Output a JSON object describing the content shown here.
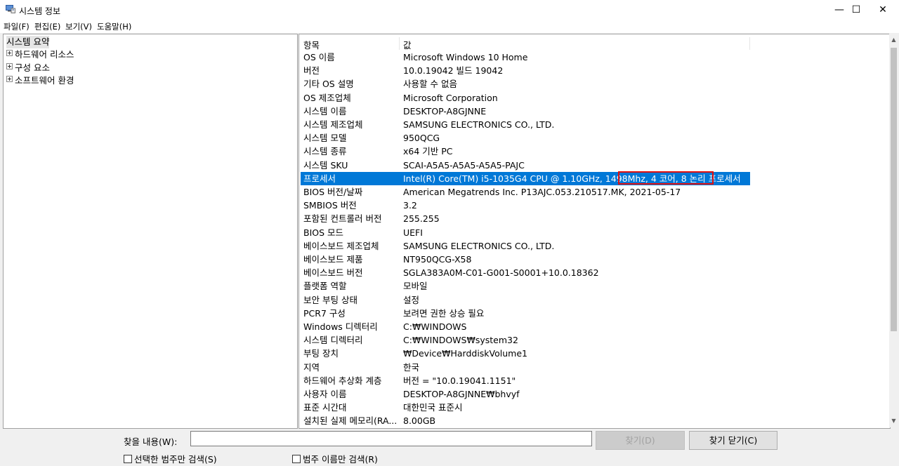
{
  "window": {
    "title": "시스템 정보"
  },
  "window_controls": {
    "minimize": "—",
    "maximize": "☐",
    "close": "✕"
  },
  "menu": [
    {
      "label": "파일(F)"
    },
    {
      "label": "편집(E)"
    },
    {
      "label": "보기(V)"
    },
    {
      "label": "도움말(H)"
    }
  ],
  "tree": {
    "items": [
      {
        "label": "시스템 요약",
        "selected": true
      },
      {
        "label": "하드웨어 리소스"
      },
      {
        "label": "구성 요소"
      },
      {
        "label": "소프트웨어 환경"
      }
    ]
  },
  "list": {
    "headers": [
      "항목",
      "값"
    ],
    "rows": [
      {
        "item": "OS 이름",
        "value": "Microsoft Windows 10 Home"
      },
      {
        "item": "버전",
        "value": "10.0.19042 빌드 19042"
      },
      {
        "item": "기타 OS 설명",
        "value": "사용할 수 없음"
      },
      {
        "item": "OS 제조업체",
        "value": "Microsoft Corporation"
      },
      {
        "item": "시스템 이름",
        "value": "DESKTOP-A8GJNNE"
      },
      {
        "item": "시스템 제조업체",
        "value": "SAMSUNG ELECTRONICS CO., LTD."
      },
      {
        "item": "시스템 모델",
        "value": "950QCG"
      },
      {
        "item": "시스템 종류",
        "value": "x64 기반 PC"
      },
      {
        "item": "시스템 SKU",
        "value": "SCAI-A5A5-A5A5-A5A5-PAJC"
      },
      {
        "item": "프로세서",
        "value": "Intel(R) Core(TM) i5-1035G4 CPU @ 1.10GHz, 1498Mhz, 4 코어, 8 논리 프로세서",
        "selected": true
      },
      {
        "item": "BIOS 버전/날짜",
        "value": "American Megatrends Inc. P13AJC.053.210517.MK, 2021-05-17"
      },
      {
        "item": "SMBIOS 버전",
        "value": "3.2"
      },
      {
        "item": "포함된 컨트롤러 버전",
        "value": "255.255"
      },
      {
        "item": "BIOS 모드",
        "value": "UEFI"
      },
      {
        "item": "베이스보드 제조업체",
        "value": "SAMSUNG ELECTRONICS CO., LTD."
      },
      {
        "item": "베이스보드 제품",
        "value": "NT950QCG-X58"
      },
      {
        "item": "베이스보드 버전",
        "value": "SGLA383A0M-C01-G001-S0001+10.0.18362"
      },
      {
        "item": "플랫폼 역할",
        "value": "모바일"
      },
      {
        "item": "보안 부팅 상태",
        "value": "설정"
      },
      {
        "item": "PCR7 구성",
        "value": "보려면 권한 상승 필요"
      },
      {
        "item": "Windows 디렉터리",
        "value": "C:₩WINDOWS"
      },
      {
        "item": "시스템 디렉터리",
        "value": "C:₩WINDOWS₩system32"
      },
      {
        "item": "부팅 장치",
        "value": "₩Device₩HarddiskVolume1"
      },
      {
        "item": "지역",
        "value": "한국"
      },
      {
        "item": "하드웨어 추상화 계층",
        "value": "버전 = \"10.0.19041.1151\""
      },
      {
        "item": "사용자 이름",
        "value": "DESKTOP-A8GJNNE₩bhvyf"
      },
      {
        "item": "표준 시간대",
        "value": "대한민국 표준시"
      },
      {
        "item": "설치된 실제 메모리(RA...",
        "value": "8.00GB"
      }
    ]
  },
  "search": {
    "label": "찾을 내용(W):",
    "value": "",
    "find_button": "찾기(D)",
    "close_find_button": "찾기 닫기(C)",
    "selected_category_only": "선택한 범주만 검색(S)",
    "category_names_only": "범주 이름만 검색(R)"
  },
  "colors": {
    "selection": "#0078d7",
    "highlight_border": "#e01010"
  },
  "icons": {
    "app": "system-info-icon",
    "expander": "plus-box-icon"
  }
}
